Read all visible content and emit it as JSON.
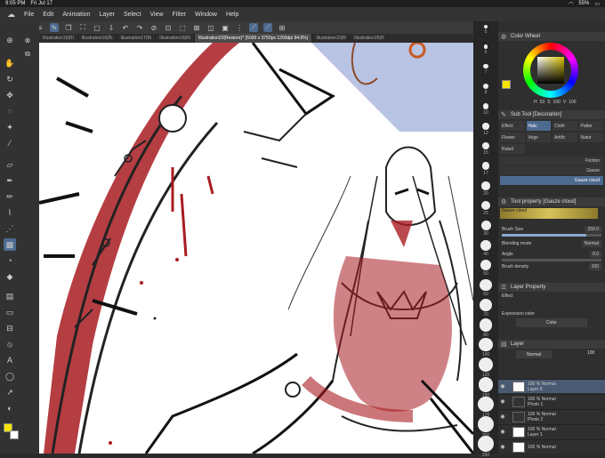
{
  "status": {
    "time": "9:05 PM",
    "date": "Fri Jul 17",
    "battery": "55%"
  },
  "menu": [
    "File",
    "Edit",
    "Animation",
    "Layer",
    "Select",
    "View",
    "Filter",
    "Window",
    "Help"
  ],
  "tabs": [
    {
      "label": "Illustration15(Ri",
      "active": false
    },
    {
      "label": "Illustration16(Ri",
      "active": false
    },
    {
      "label": "Illustration17(Ri",
      "active": false
    },
    {
      "label": "Illustration18(Ri",
      "active": false
    },
    {
      "label": "Illustration22(Restore)* (5000 x 3750px 1200dpi 94.6%)",
      "active": true
    },
    {
      "label": "Illustration23(R",
      "active": false
    },
    {
      "label": "Illustration25(R",
      "active": false
    }
  ],
  "brush_sizes": [
    "5",
    "6",
    "7",
    "8",
    "10",
    "12",
    "15",
    "17",
    "20",
    "25",
    "30",
    "40",
    "50",
    "60",
    "70",
    "80",
    "100",
    "120",
    "150",
    "170",
    "200",
    "250"
  ],
  "color_panel": {
    "title": "Color Wheel",
    "h": "53",
    "s": "100",
    "v": "100",
    "main_color": "#f5e400"
  },
  "subtool": {
    "title": "Sub Tool [Decoration]",
    "tabs": [
      "Effect",
      "Hatc",
      "Cloth",
      "Patter",
      "Flower",
      "Vege",
      "Artific",
      "Natur",
      "Ruled"
    ],
    "brushes": [
      "Friction",
      "Gauze",
      "Gauze cloud"
    ]
  },
  "tool_property": {
    "title": "Tool property [Gauze cloud]",
    "brush_name": "Gauze cloud",
    "brush_size_label": "Brush Size",
    "brush_size_value": "250.0",
    "brush_size_level": 0.85,
    "blending_label": "Blending mode",
    "blending_value": "Normal",
    "angle_label": "Angle",
    "angle_value": "0.0",
    "angle_level": 0.0,
    "density_label": "Brush density",
    "density_value": "100"
  },
  "layer_property": {
    "title": "Layer Property",
    "effect_label": "Effect",
    "expression_label": "Expression color",
    "expression_value": "Color"
  },
  "layer_panel": {
    "title": "Layer",
    "blend": "Normal",
    "opacity": "100",
    "layers": [
      {
        "line1": "100 % Normal",
        "line2": "Layer 6",
        "active": true,
        "dark": false
      },
      {
        "line1": "100 % Normal",
        "line2": "Photo 1",
        "active": false,
        "dark": true
      },
      {
        "line1": "100 % Normal",
        "line2": "Photo 2",
        "active": false,
        "dark": true
      },
      {
        "line1": "100 % Normal",
        "line2": "Layer 1",
        "active": false,
        "dark": false
      },
      {
        "line1": "100 % Normal",
        "line2": "",
        "active": false,
        "dark": false
      }
    ]
  },
  "accent": "#4d6a8f"
}
